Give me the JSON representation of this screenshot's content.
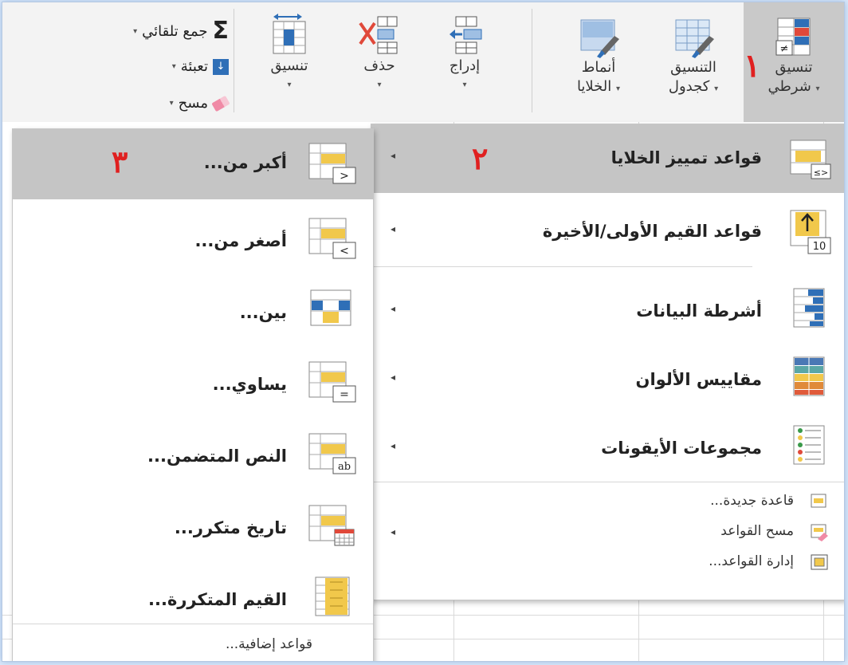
{
  "ribbon": {
    "cond_format": {
      "line1": "تنسيق",
      "line2": "شرطي",
      "step": "١"
    },
    "format_table": {
      "line1": "التنسيق",
      "line2": "كجدول"
    },
    "cell_styles": {
      "line1": "أنماط",
      "line2": "الخلايا"
    },
    "insert": {
      "label": "إدراج"
    },
    "delete": {
      "label": "حذف"
    },
    "format": {
      "label": "تنسيق"
    },
    "editing": {
      "autosum": "جمع تلقائي",
      "fill": "تعبئة",
      "clear": "مسح"
    },
    "caret": "▾"
  },
  "main_menu": {
    "items": [
      {
        "label": "قواعد تمييز الخلايا",
        "step": "٢",
        "icon": "highlight-cells-icon"
      },
      {
        "label": "قواعد القيم الأولى/الأخيرة",
        "icon": "top-bottom-icon"
      },
      {
        "label": "أشرطة البيانات",
        "icon": "data-bars-icon"
      },
      {
        "label": "مقاييس الألوان",
        "icon": "color-scales-icon"
      },
      {
        "label": "مجموعات الأيقونات",
        "icon": "icon-sets-icon"
      }
    ],
    "small_items": [
      {
        "label": "قاعدة جديدة..."
      },
      {
        "label": "مسح القواعد"
      },
      {
        "label": "إدارة القواعد..."
      }
    ],
    "icon_badge_10": "10",
    "icon_badge_le": "≤>"
  },
  "sub_menu": {
    "items": [
      {
        "label": "أكبر من...",
        "step": "٣",
        "badge": ">"
      },
      {
        "label": "أصغر من...",
        "badge": "<"
      },
      {
        "label": "بين..."
      },
      {
        "label": "يساوي...",
        "badge": "="
      },
      {
        "label": "النص المتضمن...",
        "badge": "ab"
      },
      {
        "label": "تاريخ متكرر..."
      },
      {
        "label": "القيم المتكررة..."
      }
    ],
    "more": "قواعد إضافية..."
  },
  "arrow_glyph": "◂",
  "colors": {
    "highlight": "#c5c5c5",
    "step_number": "#e02020",
    "icon_blue": "#2f6fb7",
    "icon_yellow": "#f1c84b"
  }
}
